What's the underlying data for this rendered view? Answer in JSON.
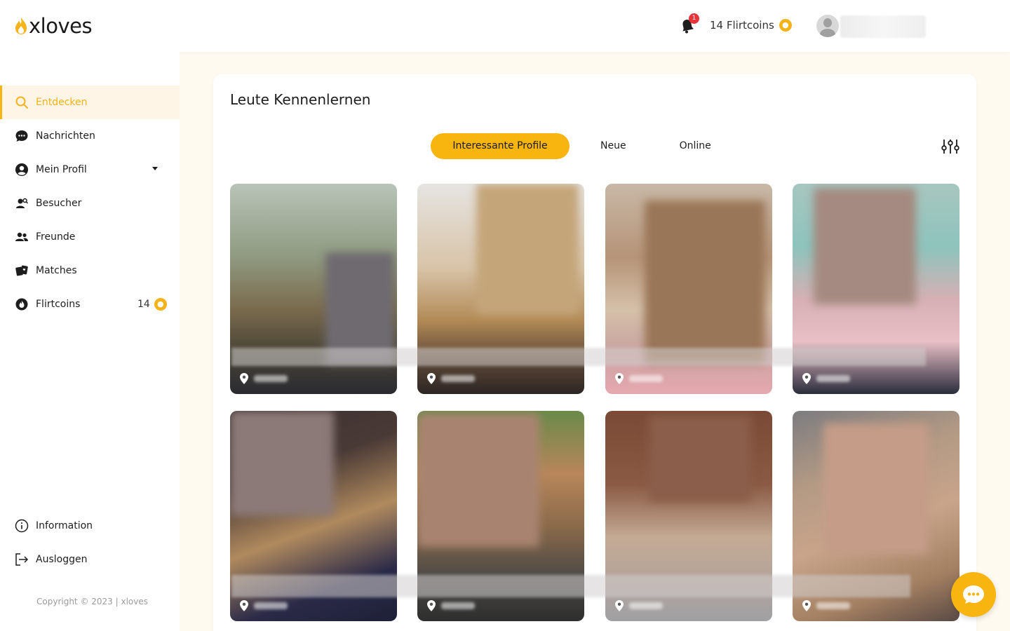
{
  "header": {
    "logo_text": "xloves",
    "notification_count": "1",
    "flirtcoins_label": "14 Flirtcoins"
  },
  "sidebar": {
    "items": [
      {
        "label": "Entdecken",
        "icon": "search-icon",
        "active": true
      },
      {
        "label": "Nachrichten",
        "icon": "chat-icon"
      },
      {
        "label": "Mein Profil",
        "icon": "user-circle-icon"
      },
      {
        "label": "Besucher",
        "icon": "visitor-icon"
      },
      {
        "label": "Freunde",
        "icon": "friends-icon"
      },
      {
        "label": "Matches",
        "icon": "cards-icon"
      },
      {
        "label": "Flirtcoins",
        "icon": "coin-icon",
        "count": "14"
      }
    ],
    "bottom_items": [
      {
        "label": "Information",
        "icon": "info-icon"
      },
      {
        "label": "Ausloggen",
        "icon": "logout-icon"
      }
    ],
    "copyright": "Copyright © 2023 | xloves"
  },
  "main": {
    "title": "Leute Kennenlernen",
    "tabs": [
      {
        "label": "Interessante Profile",
        "active": true
      },
      {
        "label": "Neue"
      },
      {
        "label": "Online"
      }
    ]
  },
  "colors": {
    "accent": "#f8b40f",
    "active_bg": "#fff5e6",
    "page_bg": "#fffaf0",
    "badge": "#e8333a"
  }
}
